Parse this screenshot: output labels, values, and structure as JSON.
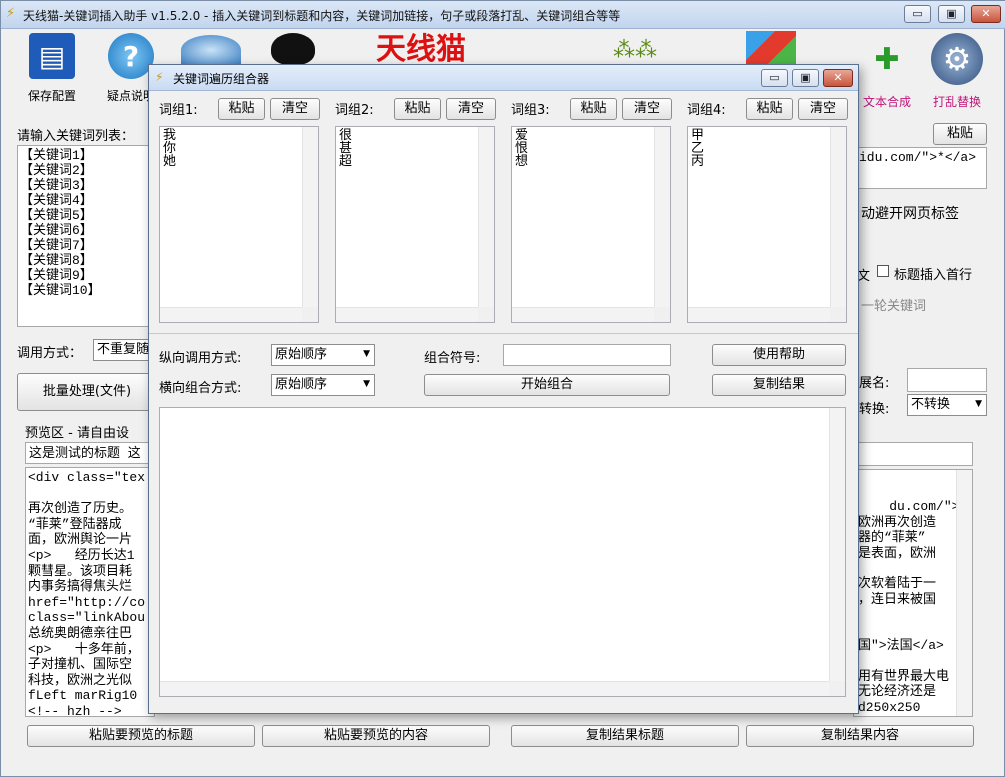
{
  "window": {
    "title": "天线猫-关键词插入助手 v1.5.2.0 - 插入关键词到标题和内容，关键词加链接，句子或段落打乱、关键词组合等等",
    "btn_min": "▭",
    "btn_max": "▣",
    "btn_close": "✕"
  },
  "toolbar": {
    "save": "保存配置",
    "help": "疑点说明",
    "brand": "天线猫",
    "text_synth": "文本合成",
    "shuffle": "打乱替换"
  },
  "left": {
    "kw_label": "请输入关键词列表：",
    "keywords": "【关键词1】\n【关键词2】\n【关键词3】\n【关键词4】\n【关键词5】\n【关键词6】\n【关键词7】\n【关键词8】\n【关键词9】\n【关键词10】",
    "call_label": "调用方式：",
    "call_value": "不重复随",
    "batch_button": "批量处理(文件)",
    "preview_label": "预览区 - 请自由设",
    "title_preview": "这是测试的标题 这",
    "content_preview": "<div class=\"tex\n\n再次创造了历史。\n“菲莱”登陆器成\n面，欧洲舆论一片\n<p>   经历长达1\n颗彗星。该项目耗\n内事务搞得焦头烂\nhref=\"http://co\nclass=\"linkAbou\n总统奥朗德亲往巴\n<p>   十多年前，\n子对撞机、国际空\n科技，欧洲之光似\nfLeft marRig10\n<!-- hzh -->"
  },
  "right": {
    "paste": "粘贴",
    "link_value": "idu.com/\">*</a>",
    "avoid_label": "动避开网页标签",
    "wen": "文",
    "title_first": "标题插入首行",
    "round_kw": "一轮关键词",
    "ext_label": "展名:",
    "convert_label": "转换:",
    "convert_value": "不转换",
    "result_text": "du.com/\">【\n欧洲再次创造\n器的“菲莱”\n是表面，欧洲\n\n次软着陆于一\n，连日来被国\n\n\n国\">法国</a>\n\n用有世界最大电\n无论经济还是\nd250x250"
  },
  "bottom": {
    "paste_title": "粘贴要预览的标题",
    "paste_content": "粘贴要预览的内容",
    "copy_title": "复制结果标题",
    "copy_content": "复制结果内容"
  },
  "dialog": {
    "title": "关键词遍历组合器",
    "paste": "粘贴",
    "clear": "清空",
    "groups": [
      {
        "label": "词组1:",
        "text": "我\n你\n她"
      },
      {
        "label": "词组2:",
        "text": "很\n甚\n超"
      },
      {
        "label": "词组3:",
        "text": "爱\n恨\n想"
      },
      {
        "label": "词组4:",
        "text": "甲\n乙\n丙"
      }
    ],
    "vertical_label": "纵向调用方式:",
    "vertical_value": "原始顺序",
    "horizontal_label": "横向组合方式:",
    "horizontal_value": "原始顺序",
    "symbol_label": "组合符号:",
    "symbol_value": "",
    "help": "使用帮助",
    "start": "开始组合",
    "copy": "复制结果",
    "result": ""
  }
}
